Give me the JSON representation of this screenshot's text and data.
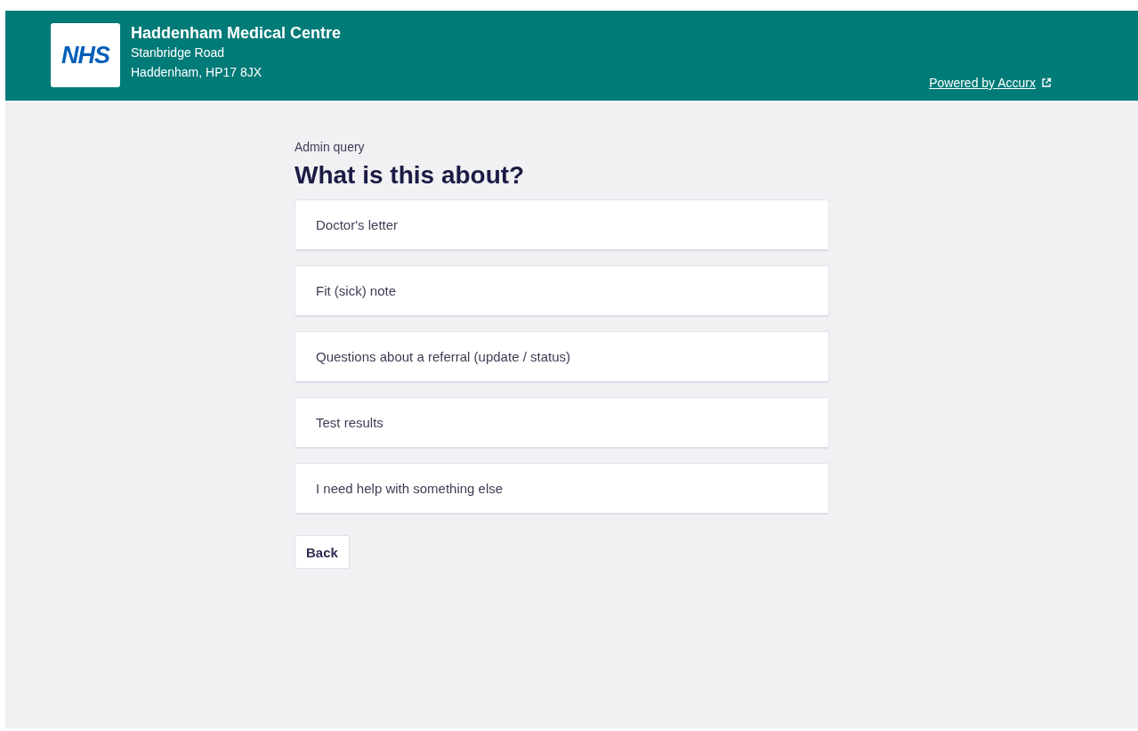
{
  "header": {
    "logo": "NHS",
    "practice_name": "Haddenham Medical Centre",
    "address_lines": [
      "Stanbridge Road",
      "Haddenham, HP17 8JX"
    ],
    "powered_by_link": "Powered by Accurx"
  },
  "main": {
    "eyebrow": "Admin query",
    "heading": "What is this about?",
    "options": [
      {
        "label": "Doctor's letter"
      },
      {
        "label": "Fit (sick) note"
      },
      {
        "label": "Questions about a referral (update / status)"
      },
      {
        "label": "Test results"
      },
      {
        "label": "I need help with something else"
      }
    ],
    "back_button": "Back"
  }
}
